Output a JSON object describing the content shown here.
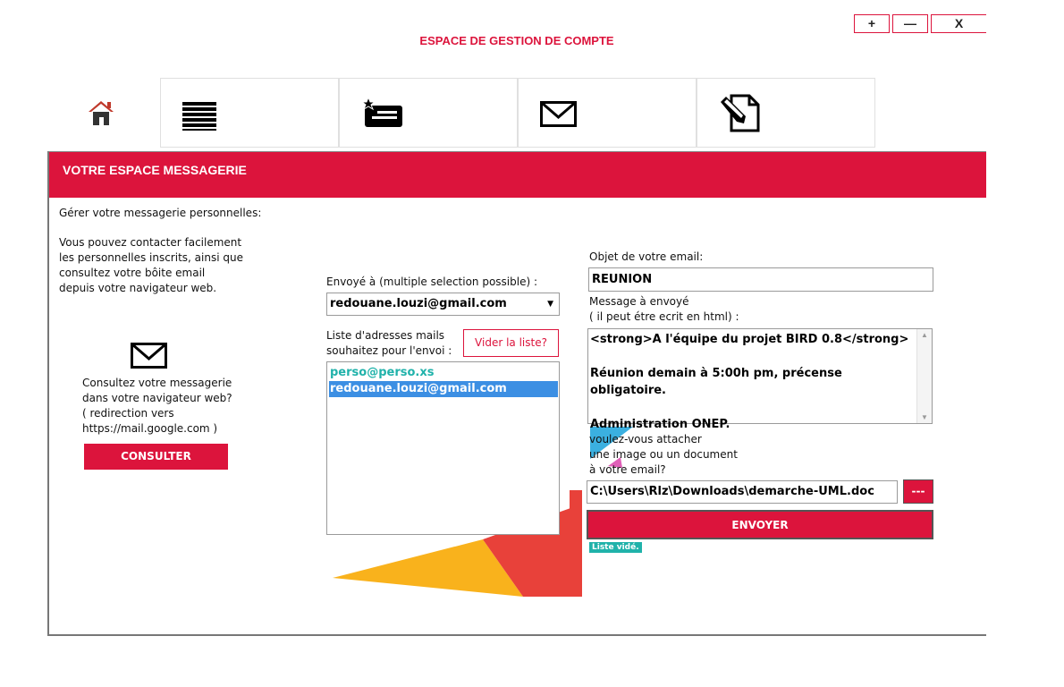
{
  "window": {
    "title": "ESPACE DE GESTION DE COMPTE",
    "btn_plus": "+",
    "btn_min": "—",
    "btn_close": "X"
  },
  "tabs": [
    {
      "icon": "home-icon"
    },
    {
      "icon": "list-icon"
    },
    {
      "icon": "starred-card-icon"
    },
    {
      "icon": "envelope-icon"
    },
    {
      "icon": "edit-document-icon"
    }
  ],
  "panel": {
    "header": "VOTRE ESPACE MESSAGERIE",
    "accent": "#dc143c"
  },
  "left": {
    "heading": "Gérer votre messagerie personnelles:",
    "intro": "Vous pouvez contacter facilement\nles personnelles inscrits, ainsi que\n consultez votre bôite email\ndepuis votre navigateur web.",
    "consult_text": "Consultez votre messagerie\n dans votre navigateur web?\n( redirection vers\n https://mail.google.com )",
    "consult_button": "CONSULTER"
  },
  "middle": {
    "to_label": "Envoyé à (multiple selection possible) :",
    "to_selected": "redouane.louzi@gmail.com",
    "list_label": "Liste d'adresses mails\nsouhaitez pour l'envoi :",
    "clear_button": "Vider la liste?",
    "addresses": [
      {
        "text": "perso@perso.xs",
        "selected": false
      },
      {
        "text": "redouane.louzi@gmail.com",
        "selected": true
      }
    ]
  },
  "right": {
    "subject_label": "Objet de votre email:",
    "subject_value": "REUNION",
    "message_label": "Message à envoyé\n ( il peut étre ecrit en html) :",
    "message_lines": [
      "<strong>A l'équipe du projet BIRD 0.8</strong>",
      "",
      "Réunion demain à 5:00h pm, précense obligatoire.",
      "",
      "Administration ONEP."
    ],
    "attach_label": "voulez-vous attacher\nune image ou un document\nà votre email?",
    "attach_path": "C:\\Users\\Rlz\\Downloads\\demarche-UML.doc",
    "browse_button": "---",
    "send_button": "ENVOYER",
    "status": "Liste vidé."
  }
}
